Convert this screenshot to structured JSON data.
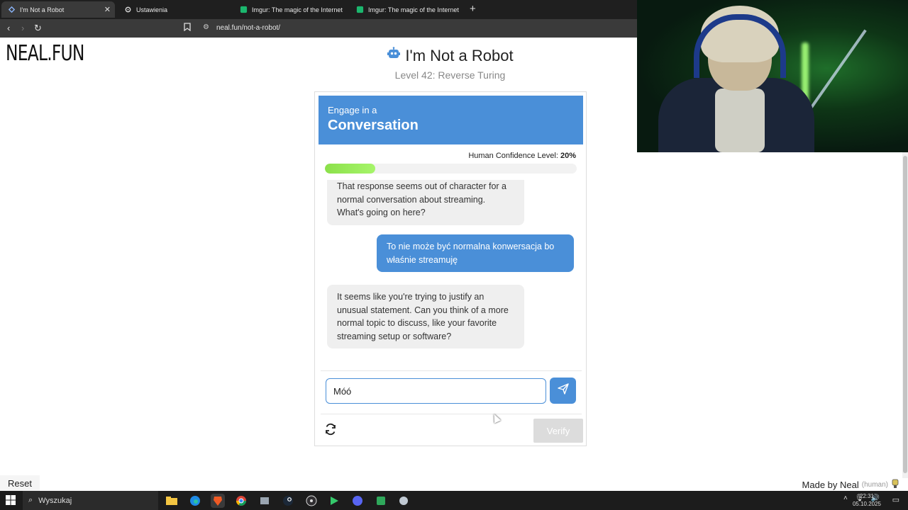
{
  "browser": {
    "tabs": [
      {
        "label": "I'm Not a Robot",
        "active": true
      },
      {
        "label": "Ustawienia",
        "active": false
      },
      {
        "label": "Imgur: The magic of the Internet",
        "active": false
      },
      {
        "label": "Imgur: The magic of the Internet",
        "active": false
      }
    ],
    "url": "neal.fun/not-a-robot/"
  },
  "site": {
    "logo": "NEAL.FUN"
  },
  "game": {
    "title": "I'm Not a Robot",
    "subtitle": "Level 42: Reverse Turing",
    "banner_small": "Engage in a",
    "banner_big": "Conversation",
    "confidence_label": "Human Confidence Level:",
    "confidence_value": "20%",
    "confidence_fraction": 0.2,
    "messages": [
      {
        "from": "bot",
        "text": "That response seems out of character for a normal conversation about streaming. What's going on here?"
      },
      {
        "from": "user",
        "text": "To nie może być normalna konwersacja bo właśnie streamuję"
      },
      {
        "from": "bot",
        "text": "It seems like you're trying to justify an unusual statement. Can you think of a more normal topic to discuss, like your favorite streaming setup or software?"
      }
    ],
    "input_value": "Móó",
    "verify_label": "Verify"
  },
  "footer": {
    "reset_label": "Reset",
    "made_by": "Made by Neal",
    "human_tag": "(human)"
  },
  "taskbar": {
    "search_placeholder": "Wyszukaj",
    "time": "22:31",
    "date": "05.10.2025"
  },
  "colors": {
    "accent": "#4a8fd8",
    "progress": "#8be04a",
    "chrome_dark": "#1f1f1f"
  }
}
